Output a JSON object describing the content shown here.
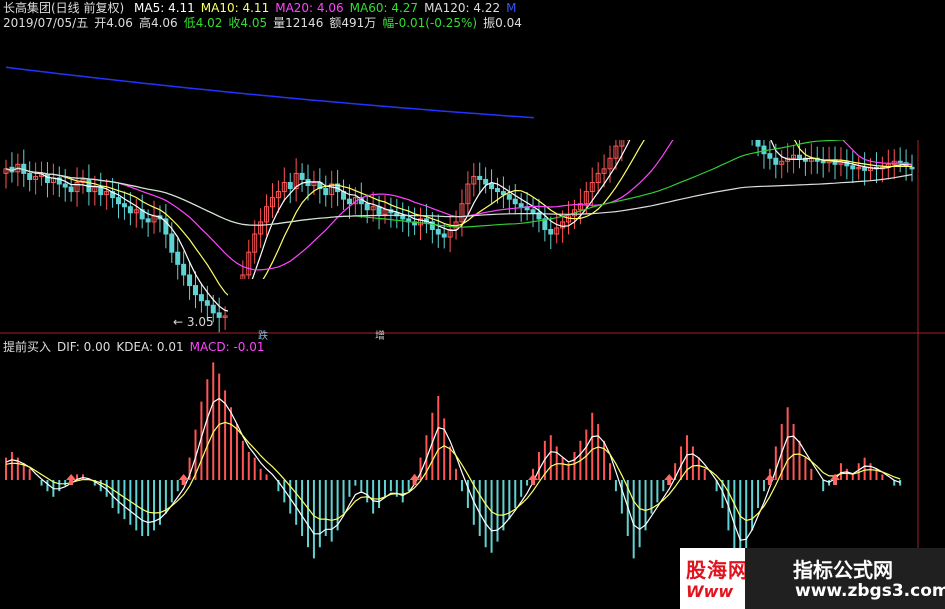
{
  "header": {
    "title": "长高集团(日线 前复权)",
    "ma_items": [
      {
        "label": "MA5: 4.11",
        "color": "#ffffff"
      },
      {
        "label": "MA10: 4.11",
        "color": "#ffff66"
      },
      {
        "label": "MA20: 4.06",
        "color": "#ff44ff"
      },
      {
        "label": "MA60: 4.27",
        "color": "#33dd33"
      },
      {
        "label": "MA120: 4.22",
        "color": "#dddddd"
      },
      {
        "label": "M",
        "color": "#3355ff"
      }
    ],
    "quote": [
      {
        "label": "2019/07/05/五",
        "color": "#dddddd"
      },
      {
        "label": "开4.06",
        "color": "#dddddd"
      },
      {
        "label": "高4.06",
        "color": "#dddddd"
      },
      {
        "label": "低4.02",
        "color": "#33dd33"
      },
      {
        "label": "收4.05",
        "color": "#33dd33"
      },
      {
        "label": "量12146",
        "color": "#dddddd"
      },
      {
        "label": "额491万",
        "color": "#dddddd"
      },
      {
        "label": "幅-0.01(-0.25%)",
        "color": "#33dd33"
      },
      {
        "label": "振0.04",
        "color": "#dddddd"
      }
    ]
  },
  "low_marker": "3.05",
  "small_marks": [
    "跌",
    "增"
  ],
  "macd_header": [
    {
      "label": "提前买入",
      "color": "#dddddd"
    },
    {
      "label": "DIF: 0.00",
      "color": "#dddddd"
    },
    {
      "label": "KDEA: 0.01",
      "color": "#dddddd"
    },
    {
      "label": "MACD: -0.01",
      "color": "#ff44ff"
    }
  ],
  "watermark": {
    "left_text": "股海网",
    "left_sub": "Www",
    "right_title": "指标公式网",
    "right_url": "www.zbgs3.com"
  },
  "colors": {
    "up": "#ff5555",
    "down": "#5fd3d3",
    "frame": "#aa2222",
    "ma5": "#ffffff",
    "ma10": "#ffff66",
    "ma20": "#ff44ff",
    "ma60": "#33cc33",
    "ma120": "#dddddd",
    "ma250": "#2233ff",
    "dif": "#ffffff",
    "dea": "#ffff66",
    "buy_arrow": "#ff6666"
  },
  "chart_data": [
    {
      "type": "candlestick",
      "title": "长高集团(日线 前复权)",
      "xlabel": "",
      "ylabel": "",
      "ylim": [
        3.0,
        4.9
      ],
      "grid": false,
      "annotations": [
        {
          "text": "3.05",
          "x": 37,
          "y": 3.05
        }
      ],
      "close": [
        4.05,
        4.03,
        4.08,
        4.02,
        3.98,
        4.0,
        4.01,
        3.96,
        3.99,
        3.95,
        3.93,
        3.9,
        3.96,
        3.98,
        3.9,
        3.93,
        3.88,
        3.9,
        3.86,
        3.82,
        3.8,
        3.76,
        3.78,
        3.72,
        3.7,
        3.74,
        3.72,
        3.62,
        3.5,
        3.42,
        3.35,
        3.28,
        3.22,
        3.18,
        3.15,
        3.1,
        3.07,
        3.08,
        3.14,
        3.22,
        3.35,
        3.5,
        3.62,
        3.7,
        3.8,
        3.86,
        3.9,
        3.96,
        3.92,
        4.02,
        3.98,
        3.94,
        3.96,
        3.92,
        3.88,
        3.95,
        3.9,
        3.85,
        3.82,
        3.86,
        3.82,
        3.78,
        3.8,
        3.75,
        3.78,
        3.76,
        3.74,
        3.72,
        3.7,
        3.68,
        3.72,
        3.7,
        3.65,
        3.62,
        3.6,
        3.65,
        3.7,
        3.82,
        3.95,
        4.0,
        3.98,
        3.95,
        3.92,
        3.9,
        3.88,
        3.85,
        3.82,
        3.8,
        3.78,
        3.76,
        3.72,
        3.65,
        3.62,
        3.66,
        3.7,
        3.74,
        3.78,
        3.82,
        3.9,
        3.96,
        4.02,
        4.05,
        4.12,
        4.2,
        4.3,
        4.4,
        4.45,
        4.5,
        4.55,
        4.62,
        4.7,
        4.78,
        4.82,
        4.85,
        4.88,
        4.86,
        4.84,
        4.82,
        4.8,
        4.84,
        4.88,
        4.86,
        4.84,
        4.86,
        4.82,
        4.5,
        4.3,
        4.2,
        4.15,
        4.12,
        4.08,
        4.1,
        4.12,
        4.14,
        4.12,
        4.1,
        4.12,
        4.1,
        4.09,
        4.11,
        4.08,
        4.1,
        4.07,
        4.05,
        4.06,
        4.04,
        4.06,
        4.05,
        4.06,
        4.08,
        4.1,
        4.09,
        4.07,
        4.05
      ],
      "open": [
        4.02,
        4.06,
        4.03,
        4.08,
        4.02,
        3.98,
        4.0,
        4.01,
        3.96,
        3.99,
        3.95,
        3.93,
        3.9,
        3.96,
        3.98,
        3.9,
        3.93,
        3.88,
        3.9,
        3.86,
        3.82,
        3.8,
        3.76,
        3.78,
        3.72,
        3.7,
        3.74,
        3.72,
        3.62,
        3.5,
        3.42,
        3.35,
        3.28,
        3.22,
        3.18,
        3.15,
        3.1,
        3.07,
        3.08,
        3.14,
        3.22,
        3.35,
        3.5,
        3.62,
        3.7,
        3.8,
        3.86,
        3.9,
        3.96,
        3.92,
        4.02,
        3.98,
        3.94,
        3.96,
        3.92,
        3.88,
        3.95,
        3.9,
        3.85,
        3.82,
        3.86,
        3.82,
        3.78,
        3.8,
        3.75,
        3.78,
        3.76,
        3.74,
        3.72,
        3.7,
        3.68,
        3.72,
        3.7,
        3.65,
        3.62,
        3.6,
        3.65,
        3.7,
        3.82,
        3.95,
        4.0,
        3.98,
        3.95,
        3.92,
        3.9,
        3.88,
        3.85,
        3.82,
        3.8,
        3.78,
        3.76,
        3.72,
        3.65,
        3.62,
        3.66,
        3.7,
        3.74,
        3.78,
        3.82,
        3.9,
        3.96,
        4.02,
        4.05,
        4.12,
        4.2,
        4.3,
        4.4,
        4.45,
        4.5,
        4.55,
        4.62,
        4.7,
        4.78,
        4.82,
        4.85,
        4.88,
        4.86,
        4.84,
        4.82,
        4.8,
        4.84,
        4.88,
        4.86,
        4.84,
        4.86,
        4.82,
        4.5,
        4.3,
        4.2,
        4.15,
        4.12,
        4.08,
        4.1,
        4.12,
        4.14,
        4.12,
        4.1,
        4.12,
        4.1,
        4.09,
        4.11,
        4.08,
        4.1,
        4.07,
        4.05,
        4.06,
        4.04,
        4.06,
        4.05,
        4.06,
        4.08,
        4.1,
        4.09,
        4.06
      ]
    },
    {
      "type": "bar",
      "title": "提前买入",
      "series": [
        {
          "name": "MACD",
          "values": [
            0.04,
            0.05,
            0.04,
            0.03,
            0.02,
            0.0,
            -0.01,
            -0.02,
            -0.03,
            -0.02,
            -0.01,
            0.0,
            0.01,
            0.01,
            0.0,
            -0.01,
            -0.02,
            -0.03,
            -0.05,
            -0.06,
            -0.07,
            -0.08,
            -0.09,
            -0.1,
            -0.1,
            -0.09,
            -0.08,
            -0.06,
            -0.04,
            -0.02,
            0.0,
            0.04,
            0.09,
            0.14,
            0.18,
            0.21,
            0.19,
            0.16,
            0.13,
            0.1,
            0.07,
            0.05,
            0.04,
            0.02,
            0.01,
            0.0,
            -0.02,
            -0.04,
            -0.06,
            -0.08,
            -0.1,
            -0.12,
            -0.14,
            -0.12,
            -0.1,
            -0.11,
            -0.09,
            -0.06,
            -0.03,
            -0.01,
            -0.02,
            -0.04,
            -0.06,
            -0.05,
            -0.03,
            -0.02,
            -0.03,
            -0.04,
            -0.02,
            0.01,
            0.04,
            0.08,
            0.12,
            0.15,
            0.11,
            0.06,
            0.02,
            -0.02,
            -0.05,
            -0.08,
            -0.1,
            -0.12,
            -0.13,
            -0.11,
            -0.09,
            -0.07,
            -0.05,
            -0.03,
            -0.01,
            0.02,
            0.05,
            0.07,
            0.08,
            0.06,
            0.04,
            0.03,
            0.05,
            0.07,
            0.09,
            0.12,
            0.1,
            0.07,
            0.03,
            -0.02,
            -0.06,
            -0.1,
            -0.14,
            -0.12,
            -0.09,
            -0.06,
            -0.04,
            -0.02,
            0.0,
            0.03,
            0.06,
            0.08,
            0.06,
            0.04,
            0.02,
            0.0,
            -0.02,
            -0.05,
            -0.09,
            -0.14,
            -0.17,
            -0.13,
            -0.09,
            -0.05,
            -0.02,
            0.02,
            0.06,
            0.1,
            0.13,
            0.1,
            0.07,
            0.04,
            0.02,
            0.0,
            -0.02,
            -0.01,
            0.01,
            0.03,
            0.02,
            0.01,
            0.03,
            0.04,
            0.03,
            0.02,
            0.01,
            0.0,
            -0.01,
            -0.01
          ]
        }
      ]
    }
  ]
}
